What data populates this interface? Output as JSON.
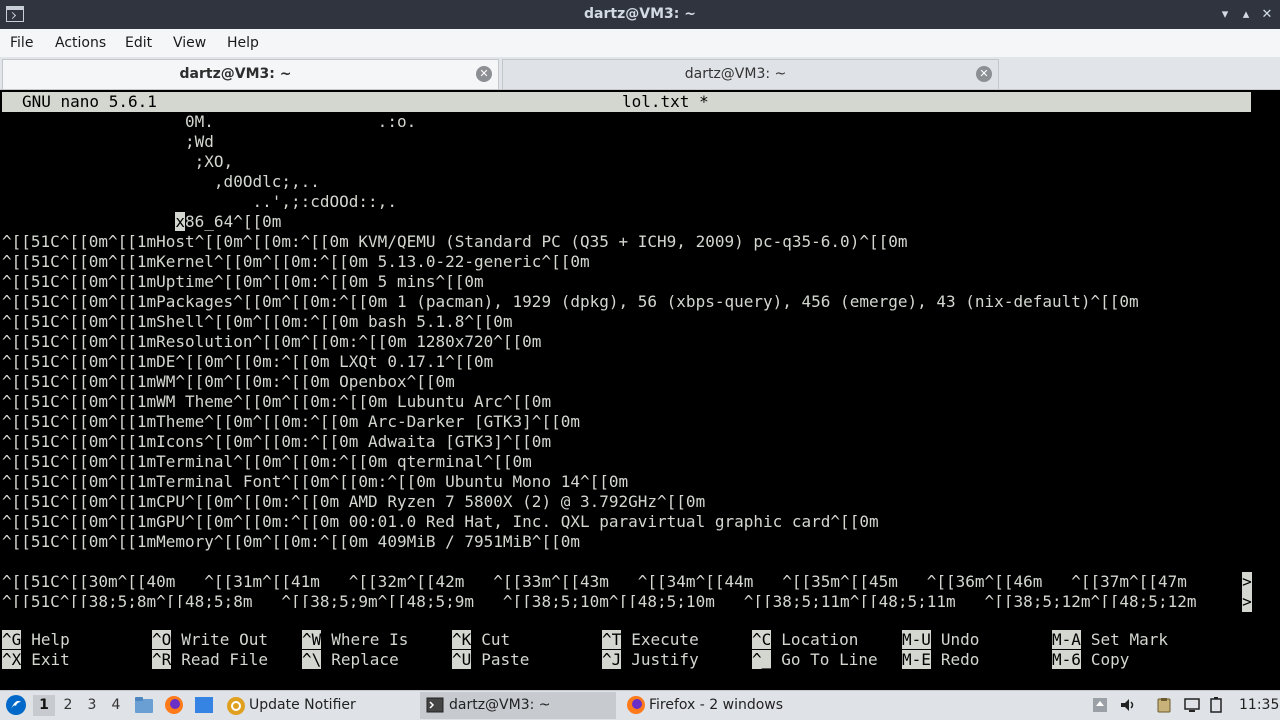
{
  "window": {
    "title": "dartz@VM3: ~",
    "minimize_glyph": "▾",
    "maximize_glyph": "▴",
    "close_glyph": "✕",
    "app_icon": "terminal-icon"
  },
  "menu": [
    "File",
    "Actions",
    "Edit",
    "View",
    "Help"
  ],
  "tabs": [
    {
      "label": "dartz@VM3: ~",
      "active": true,
      "close_glyph": "✕"
    },
    {
      "label": "dartz@VM3: ~",
      "active": false,
      "close_glyph": "✕"
    }
  ],
  "nano": {
    "version": "GNU nano 5.6.1",
    "filename": "lol.txt *",
    "lines": [
      "                   0M.                 .:o.",
      "                   ;Wd",
      "                    ;XO,",
      "                      ,d0Odlc;,..",
      "                          ..',;:cdOOd::,.",
      "",
      "^[[51C^[[0m^[[1mHost^[[0m^[[0m:^[[0m KVM/QEMU (Standard PC (Q35 + ICH9, 2009) pc-q35-6.0)^[[0m",
      "^[[51C^[[0m^[[1mKernel^[[0m^[[0m:^[[0m 5.13.0-22-generic^[[0m",
      "^[[51C^[[0m^[[1mUptime^[[0m^[[0m:^[[0m 5 mins^[[0m",
      "^[[51C^[[0m^[[1mPackages^[[0m^[[0m:^[[0m 1 (pacman), 1929 (dpkg), 56 (xbps-query), 456 (emerge), 43 (nix-default)^[[0m",
      "^[[51C^[[0m^[[1mShell^[[0m^[[0m:^[[0m bash 5.1.8^[[0m",
      "^[[51C^[[0m^[[1mResolution^[[0m^[[0m:^[[0m 1280x720^[[0m",
      "^[[51C^[[0m^[[1mDE^[[0m^[[0m:^[[0m LXQt 0.17.1^[[0m",
      "^[[51C^[[0m^[[1mWM^[[0m^[[0m:^[[0m Openbox^[[0m",
      "^[[51C^[[0m^[[1mWM Theme^[[0m^[[0m:^[[0m Lubuntu Arc^[[0m",
      "^[[51C^[[0m^[[1mTheme^[[0m^[[0m:^[[0m Arc-Darker [GTK3]^[[0m",
      "^[[51C^[[0m^[[1mIcons^[[0m^[[0m:^[[0m Adwaita [GTK3]^[[0m",
      "^[[51C^[[0m^[[1mTerminal^[[0m^[[0m:^[[0m qterminal^[[0m",
      "^[[51C^[[0m^[[1mTerminal Font^[[0m^[[0m:^[[0m Ubuntu Mono 14^[[0m",
      "^[[51C^[[0m^[[1mCPU^[[0m^[[0m:^[[0m AMD Ryzen 7 5800X (2) @ 3.792GHz^[[0m",
      "^[[51C^[[0m^[[1mGPU^[[0m^[[0m:^[[0m 00:01.0 Red Hat, Inc. QXL paravirtual graphic card^[[0m",
      "^[[51C^[[0m^[[1mMemory^[[0m^[[0m:^[[0m 409MiB / 7951MiB^[[0m",
      "",
      "^[[51C^[[30m^[[40m   ^[[31m^[[41m   ^[[32m^[[42m   ^[[33m^[[43m   ^[[34m^[[44m   ^[[35m^[[45m   ^[[36m^[[46m   ^[[37m^[[47m ",
      "^[[51C^[[38;5;8m^[[48;5;8m   ^[[38;5;9m^[[48;5;9m   ^[[38;5;10m^[[48;5;10m   ^[[38;5;11m^[[48;5;11m   ^[[38;5;12m^[[48;5;12m"
    ],
    "cursor_line": {
      "indent": "                  ",
      "cursor_char": "x",
      "rest": "86_64^[[0m"
    },
    "truncation_marker": ">",
    "shortcuts": [
      {
        "key": "^G",
        "label": "Help"
      },
      {
        "key": "^O",
        "label": "Write Out"
      },
      {
        "key": "^W",
        "label": "Where Is"
      },
      {
        "key": "^K",
        "label": "Cut"
      },
      {
        "key": "^T",
        "label": "Execute"
      },
      {
        "key": "^C",
        "label": "Location"
      },
      {
        "key": "M-U",
        "label": "Undo"
      },
      {
        "key": "M-A",
        "label": "Set Mark"
      },
      {
        "key": "^X",
        "label": "Exit"
      },
      {
        "key": "^R",
        "label": "Read File"
      },
      {
        "key": "^\\",
        "label": "Replace"
      },
      {
        "key": "^U",
        "label": "Paste"
      },
      {
        "key": "^J",
        "label": "Justify"
      },
      {
        "key": "^_",
        "label": "Go To Line"
      },
      {
        "key": "M-E",
        "label": "Redo"
      },
      {
        "key": "M-6",
        "label": "Copy"
      }
    ]
  },
  "taskbar": {
    "desktops": [
      "1",
      "2",
      "3",
      "4"
    ],
    "active_desktop": "1",
    "tasks": [
      {
        "label": "Update Notifier",
        "icon": "update-notifier-icon"
      },
      {
        "label": "dartz@VM3: ~",
        "icon": "terminal-icon",
        "active": true
      },
      {
        "label": "Firefox - 2 windows",
        "icon": "firefox-icon"
      }
    ],
    "clock": "11:35",
    "tray_icons": [
      "eject-icon",
      "volume-icon",
      "clipboard-icon",
      "network-icon",
      "battery-icon",
      "power-icon"
    ]
  },
  "colors": {
    "titlebar_bg": "#2f343f",
    "menubar_bg": "#f5f6f7",
    "terminal_bg": "#000000",
    "terminal_fg": "#d3d7cf",
    "taskbar_bg": "#dfe2e6"
  }
}
